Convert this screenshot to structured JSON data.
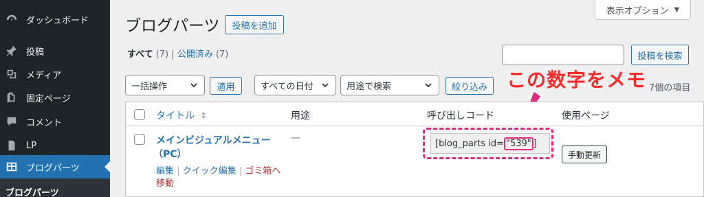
{
  "sidebar": {
    "items": [
      {
        "label": "ダッシュボード",
        "icon": "dashboard-icon"
      },
      {
        "label": "投稿",
        "icon": "pin-icon"
      },
      {
        "label": "メディア",
        "icon": "media-icon"
      },
      {
        "label": "固定ページ",
        "icon": "page-icon"
      },
      {
        "label": "コメント",
        "icon": "comment-icon"
      },
      {
        "label": "LP",
        "icon": "document-icon"
      },
      {
        "label": "ブログパーツ",
        "icon": "table-icon"
      }
    ],
    "submenu_current": "ブログパーツ"
  },
  "header": {
    "title": "ブログパーツ",
    "add_new_label": "投稿を追加",
    "screen_options_label": "表示オプション"
  },
  "views": {
    "all_label": "すべて",
    "all_count": "(7)",
    "separator": "|",
    "published_label": "公開済み",
    "published_count": "(7)"
  },
  "search": {
    "value": "",
    "button_label": "投稿を検索"
  },
  "filters": {
    "bulk_action": "一括操作",
    "apply_label": "適用",
    "date_filter": "すべての日付",
    "usage_filter": "用途で検索",
    "filter_button_label": "絞り込み",
    "item_count": "7個の項目"
  },
  "annotation": {
    "text": "この数字をメモ",
    "color": "#ff2a2a"
  },
  "table": {
    "columns": [
      "タイトル",
      "用途",
      "呼び出しコード",
      "使用ページ"
    ],
    "rows": [
      {
        "title_line1": "メインビジュアルメニュー",
        "title_line2": "（PC）",
        "usage": "—",
        "code_prefix": "[blog_parts id=",
        "code_id": "\"539\"",
        "code_suffix": "]",
        "actions": {
          "edit": "編集",
          "quick_edit": "クイック編集",
          "trash_line1": "ゴミ箱へ",
          "trash_line2": "移動",
          "sep": "|"
        },
        "refresh_label": "手動更新"
      }
    ]
  },
  "colors": {
    "sidebar_bg": "#1d2327",
    "accent": "#2271b1",
    "highlight": "#e02a7e"
  }
}
